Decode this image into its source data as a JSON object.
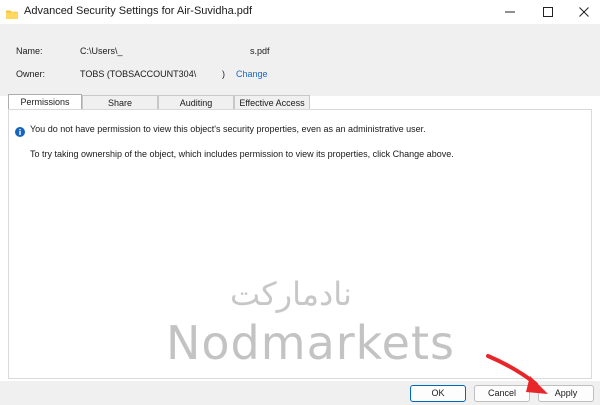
{
  "window": {
    "title": "Advanced Security Settings for Air-Suvidha.pdf",
    "icons": {
      "app": "folder-icon",
      "minimize": "minimize-icon",
      "maximize": "maximize-icon",
      "close": "close-icon"
    }
  },
  "header": {
    "name_label": "Name:",
    "name_value_start": "C:\\Users\\_",
    "name_value_end": "s.pdf",
    "owner_label": "Owner:",
    "owner_value_start": "TOBS (TOBSACCOUNT304\\",
    "owner_value_end": ")",
    "change_link": "Change"
  },
  "tabs": [
    {
      "label": "Permissions",
      "active": true
    },
    {
      "label": "Share",
      "active": false
    },
    {
      "label": "Auditing",
      "active": false
    },
    {
      "label": "Effective Access",
      "active": false
    }
  ],
  "panel": {
    "info_icon": "info-icon",
    "message_primary": "You do not have permission to view this object's security properties, even as an administrative user.",
    "message_secondary": "To try taking ownership of the object, which includes permission to view its properties, click Change above."
  },
  "watermark": {
    "arabic": "نادمارکت",
    "latin": "Nodmarkets"
  },
  "buttons": {
    "ok": "OK",
    "cancel": "Cancel",
    "apply": "Apply"
  },
  "annotation": {
    "arrow_color": "#e8262a",
    "icon": "red-arrow-icon"
  }
}
